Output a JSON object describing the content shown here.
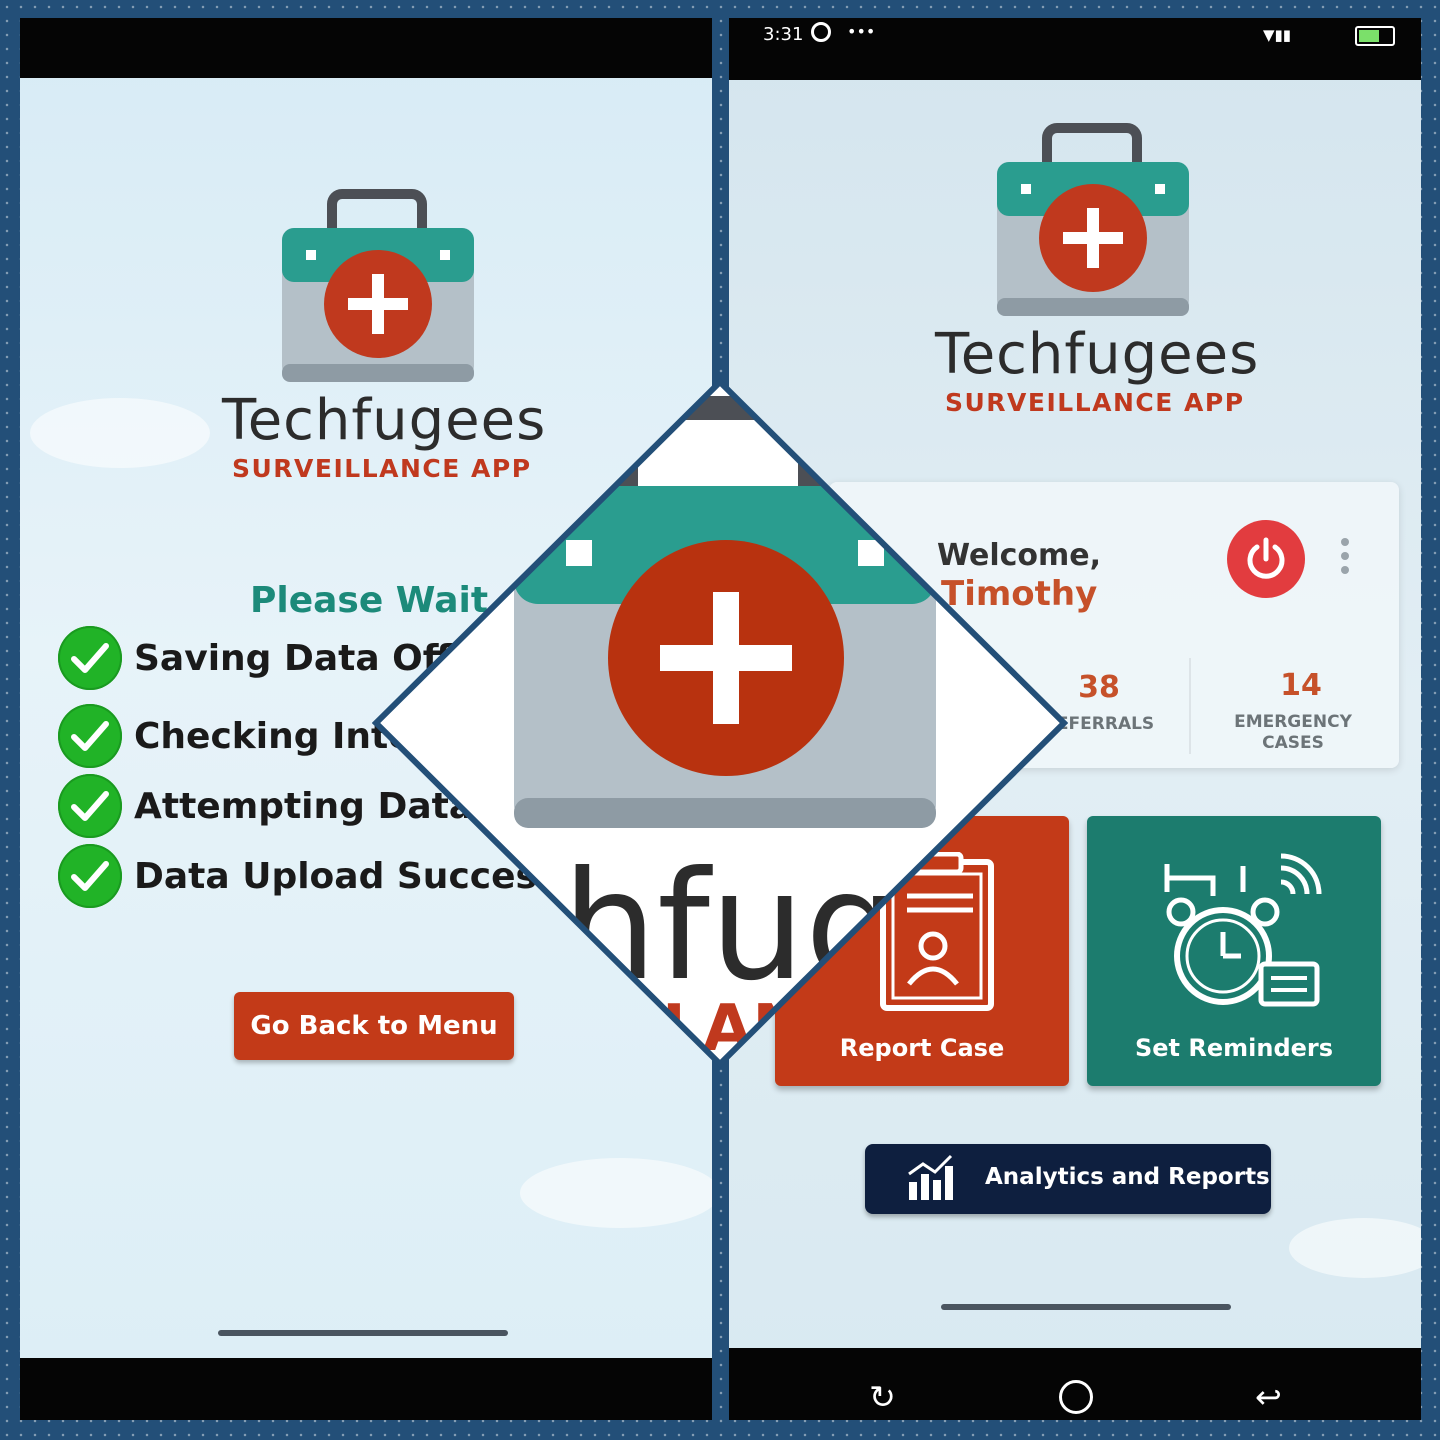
{
  "brand": {
    "title": "Techfugees",
    "subtitle": "SURVEILLANCE APP"
  },
  "left_screen": {
    "heading": "Please Wait...",
    "steps": [
      {
        "label": "Saving Data Offline"
      },
      {
        "label": "Checking Internet"
      },
      {
        "label": "Attempting Data"
      },
      {
        "label": "Data Upload Success"
      }
    ],
    "back_button": "Go Back to Menu"
  },
  "right_screen": {
    "status_bar": {
      "time": "3:31",
      "more": "•••"
    },
    "welcome": {
      "greeting": "Welcome,",
      "name": "Timothy"
    },
    "stats": [
      {
        "value": "38",
        "label": "REFERRALS"
      },
      {
        "value": "14",
        "label_line1": "EMERGENCY",
        "label_line2": "CASES"
      }
    ],
    "tiles": {
      "report_case": "Report Case",
      "set_reminders": "Set Reminders"
    },
    "analytics_button": "Analytics and Reports"
  },
  "center_overlay": {
    "title_fragment": "hfugees",
    "subtitle_fragment": "LAN"
  },
  "colors": {
    "frame": "#234f78",
    "brand_red": "#c0391e",
    "teal": "#1c7c6e",
    "navy": "#0e1f3f",
    "check_green": "#21b327",
    "power_red": "#e23c3f"
  }
}
